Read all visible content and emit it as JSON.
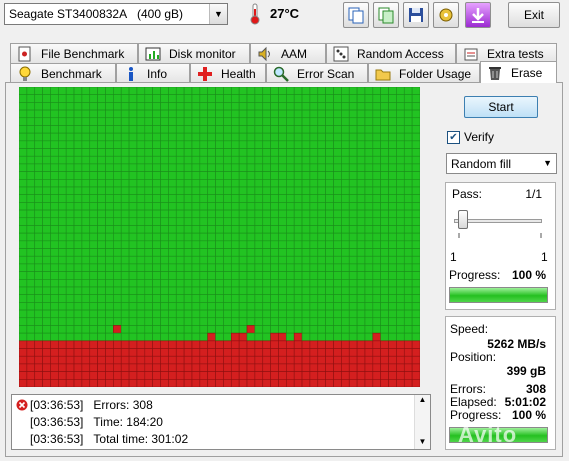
{
  "toolbar": {
    "drive_name": "Seagate ST3400832A",
    "drive_size": "(400 gB)",
    "temperature": "27°C",
    "exit_label": "Exit",
    "buttons": [
      {
        "name": "copy-text-icon",
        "icon": "copy"
      },
      {
        "name": "copy-image-icon",
        "icon": "copy-image"
      },
      {
        "name": "save-icon",
        "icon": "floppy"
      },
      {
        "name": "options-icon",
        "icon": "wrench"
      },
      {
        "name": "download-icon",
        "icon": "arrow-down"
      }
    ]
  },
  "tabs_row1": [
    {
      "label": "File Benchmark",
      "icon": "file-icon"
    },
    {
      "label": "Disk monitor",
      "icon": "monitor-chart-icon"
    },
    {
      "label": "AAM",
      "icon": "speaker-icon"
    },
    {
      "label": "Random Access",
      "icon": "dice-icon"
    },
    {
      "label": "Extra tests",
      "icon": "puzzle-icon"
    }
  ],
  "tabs_row2": [
    {
      "label": "Benchmark",
      "icon": "lightbulb-icon"
    },
    {
      "label": "Info",
      "icon": "info-icon"
    },
    {
      "label": "Health",
      "icon": "cross-icon"
    },
    {
      "label": "Error Scan",
      "icon": "magnifier-icon"
    },
    {
      "label": "Folder Usage",
      "icon": "folder-icon"
    },
    {
      "label": "Erase",
      "icon": "trash-icon",
      "active": true
    }
  ],
  "erase": {
    "start_label": "Start",
    "verify_label": "Verify",
    "verify_checked": true,
    "fill_mode": "Random fill",
    "pass_label": "Pass:",
    "pass_value": "1/1",
    "slider_min": "1",
    "slider_max": "1",
    "slider_value": 1,
    "progress_label": "Progress:",
    "progress_value": "100 %",
    "pass_progress": 1.0,
    "speed_label": "Speed:",
    "speed_value": "5262 MB/s",
    "position_label": "Position:",
    "position_value": "399 gB",
    "errors_label": "Errors:",
    "errors_value": "308",
    "elapsed_label": "Elapsed:",
    "elapsed_value": "5:01:02",
    "total_progress_label": "Progress:",
    "total_progress_value": "100 %",
    "total_progress": 1.0
  },
  "block_map": {
    "columns": 51,
    "rows": 39,
    "ok_color": "#22c322",
    "error_color": "#d41f1f",
    "grid_color": "#1a8f1a",
    "error_rows_from": 33,
    "scattered_errors": [
      [
        12,
        31
      ],
      [
        24,
        32
      ],
      [
        27,
        32
      ],
      [
        28,
        32
      ],
      [
        29,
        31
      ],
      [
        32,
        32
      ],
      [
        33,
        32
      ],
      [
        35,
        32
      ],
      [
        45,
        32
      ]
    ]
  },
  "log": [
    {
      "time": "[03:36:53]",
      "text": "Errors: 308",
      "icon": "error-icon"
    },
    {
      "time": "[03:36:53]",
      "text": "Time: 184:20",
      "icon": ""
    },
    {
      "time": "[03:36:53]",
      "text": "Total time: 301:02",
      "icon": ""
    }
  ],
  "watermark": "Avito"
}
